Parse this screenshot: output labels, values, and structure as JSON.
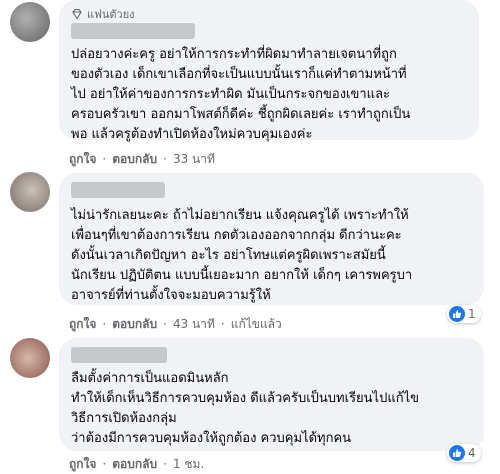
{
  "comments": [
    {
      "badge": "แฟนตัวยง",
      "text": "ปล่อยวางค่ะครู อย่าให้การกระทำที่ผิดมาทำลายเจตนาที่ถูก\nของตัวเอง เด็กเขาเลือกที่จะเป็นแบบนั้นเราก็แค่ทำตามหน้าที่\nไป อย่าให้ค่าของการกระทำผิด มันเป็นกระจกของเขาและ\nครอบครัวเขา ออกมาโพสต์ก็ดีค่ะ ชี้ถูกผิดเลยค่ะ เราทำถูกเป็น\nพอ แล้วครูต้องทำเปิดห้องใหม่ควบคุมเองค่ะ",
      "like_label": "ถูกใจ",
      "reply_label": "ตอบกลับ",
      "time": "33 นาที"
    },
    {
      "text": "ไม่น่ารักเลยนะคะ ถ้าไม่อยากเรียน แจ้งคุณครูได้ เพราะทำให้\nเพื่อนๆที่เขาต้องการเรียน กดตัวเองออกจากกลุ่ม ดีกว่านะคะ\nดังนั้นเวลาเกิดปัญหา อะไร อย่าโทษแต่ครูผิดเพราะสมัยนี้\nนักเรียน ปฏิบัติตน แบบนี้เยอะมาก อยากให้ เด็กๆ เคารพครูบา\nอาจารย์ที่ท่านตั้งใจจะมอบความรู้ให้",
      "like_label": "ถูกใจ",
      "reply_label": "ตอบกลับ",
      "time": "43 นาที",
      "edited": "แก้ไขแล้ว",
      "reaction_count": "1"
    },
    {
      "text": "ลืมตั้งค่าการเป็นแอดมินหลัก\nทำให้เด็กเห็นวิธีการควบคุมห้อง ดีแล้วครับเป็นบทเรียนไปแก้ไข\nวิธีการเปิดห้องกลุ่ม\nว่าต้องมีการควบคุมห้องให้ถูกต้อง ควบคุมได้ทุกคน",
      "like_label": "ถูกใจ",
      "reply_label": "ตอบกลับ",
      "time": "1 ชม.",
      "reaction_count": "4"
    }
  ],
  "colors": {
    "bubble": "#f0f2f5",
    "secondary_text": "#65676b",
    "like_blue": "#1877f2"
  }
}
